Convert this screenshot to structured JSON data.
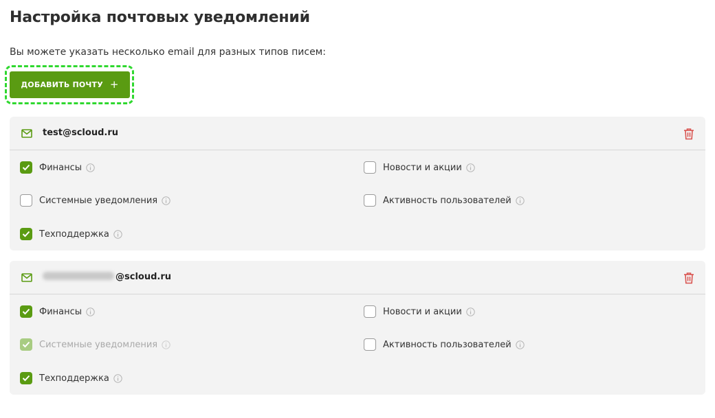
{
  "page": {
    "title": "Настройка почтовых уведомлений",
    "subtitle": "Вы можете указать несколько email для разных типов писем:"
  },
  "add_button": {
    "label": "ДОБАВИТЬ ПОЧТУ",
    "icon": "plus-icon"
  },
  "colors": {
    "accent": "#5a9b12",
    "delete": "#d9534f",
    "highlight": "#2fd82f"
  },
  "cards": [
    {
      "email": "test@scloud.ru",
      "options": {
        "finance": {
          "label": "Финансы",
          "checked": true
        },
        "news": {
          "label": "Новости и акции",
          "checked": false
        },
        "system": {
          "label": "Системные уведомления",
          "checked": false
        },
        "activity": {
          "label": "Активность пользователей",
          "checked": false
        },
        "support": {
          "label": "Техподдержка",
          "checked": true
        }
      }
    },
    {
      "email_domain": "@scloud.ru",
      "email_local_blurred": true,
      "options": {
        "finance": {
          "label": "Финансы",
          "checked": true
        },
        "news": {
          "label": "Новости и акции",
          "checked": false
        },
        "system": {
          "label": "Системные уведомления",
          "checked": true,
          "disabled": true
        },
        "activity": {
          "label": "Активность пользователей",
          "checked": false
        },
        "support": {
          "label": "Техподдержка",
          "checked": true
        }
      }
    }
  ]
}
